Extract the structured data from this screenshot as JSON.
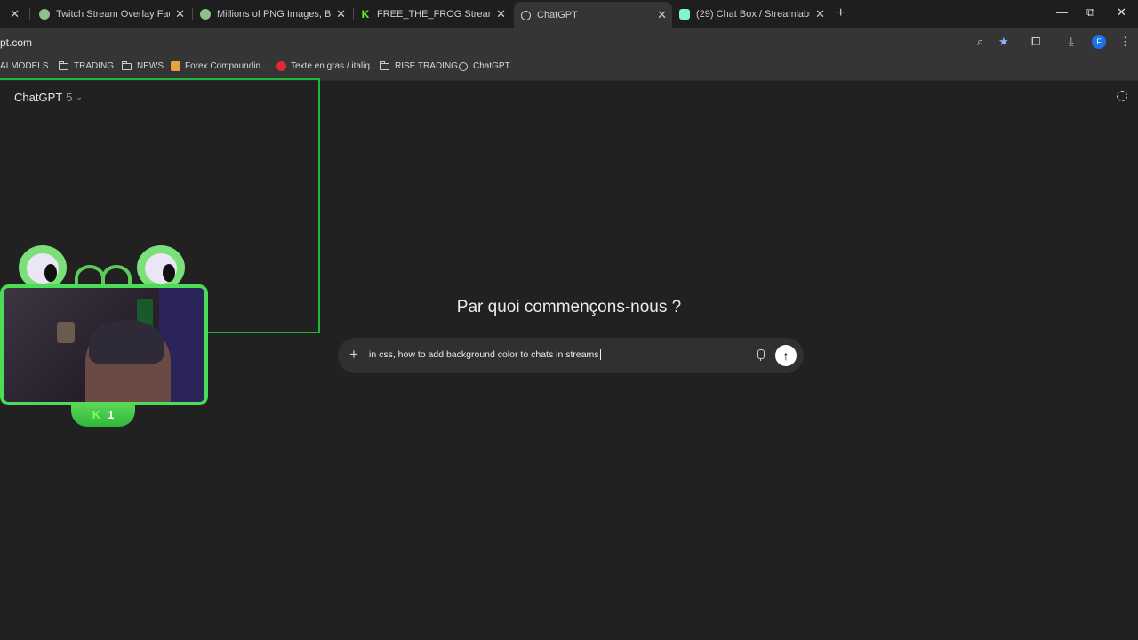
{
  "tabs": [
    {
      "title": "Twitch Stream Overlay Facecam",
      "fav": "globe-icon",
      "active": false
    },
    {
      "title": "Millions of PNG Images, Backgr",
      "fav": "globe-icon",
      "active": false
    },
    {
      "title": "FREE_THE_FROG Stream - Watch",
      "fav": "K",
      "active": false
    },
    {
      "title": "ChatGPT",
      "fav": "chatgpt-icon",
      "active": true
    },
    {
      "title": "(29) Chat Box / Streamlabs",
      "fav": "streamlabs-icon",
      "active": false
    }
  ],
  "address": {
    "url": "pt.com"
  },
  "bookmarks": [
    {
      "label": "AI MODELS",
      "type": "folder"
    },
    {
      "label": "TRADING",
      "type": "folder"
    },
    {
      "label": "NEWS",
      "type": "folder"
    },
    {
      "label": "Forex Compoundin...",
      "type": "link"
    },
    {
      "label": "Texte en gras / italiq...",
      "type": "link"
    },
    {
      "label": "RISE TRADING",
      "type": "folder"
    },
    {
      "label": "ChatGPT",
      "type": "link"
    }
  ],
  "app": {
    "model_name": "ChatGPT",
    "model_version": "5",
    "heading": "Par quoi commençons-nous ?",
    "prompt_text": "in css, how to add background color to chats in streams"
  },
  "profile": {
    "initial": "F"
  },
  "overlay": {
    "badge_count": "1",
    "badge_letter": "K"
  },
  "colors": {
    "accent_green": "#4bdc58",
    "page_bg": "#212121",
    "composer_bg": "#303030"
  }
}
